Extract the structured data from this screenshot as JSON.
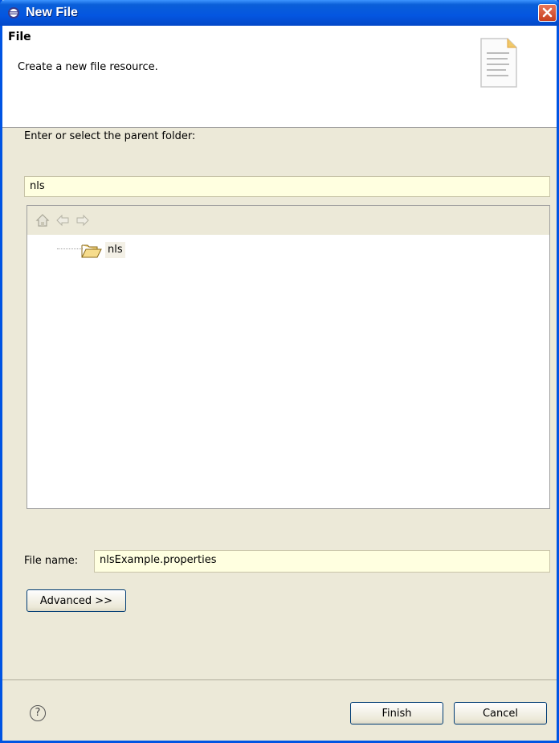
{
  "window": {
    "title": "New File"
  },
  "header": {
    "title": "File",
    "description": "Create a new file resource."
  },
  "parent_folder": {
    "label": "Enter or select the parent folder:",
    "value": "nls"
  },
  "tree": {
    "toolbar": [
      "home-icon",
      "back-icon",
      "forward-icon"
    ],
    "items": [
      {
        "label": "nls"
      }
    ]
  },
  "file_name": {
    "label": "File name:",
    "value": "nlsExample.properties"
  },
  "buttons": {
    "advanced": "Advanced >>",
    "finish": "Finish",
    "cancel": "Cancel",
    "help": "?"
  }
}
